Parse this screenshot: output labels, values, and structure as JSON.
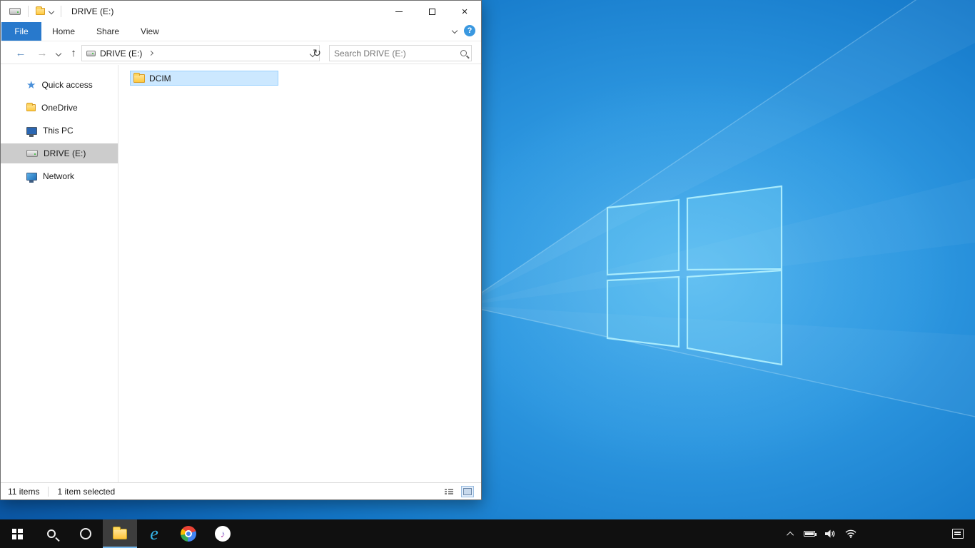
{
  "colors": {
    "accent_blue": "#0078d7",
    "file_tab_blue": "#2879cc",
    "selection_fill": "#cce8ff",
    "selection_border": "#99d1ff",
    "sidebar_selected_gray": "#cccccc",
    "taskbar_bg": "#101010",
    "wallpaper_light": "#41abec",
    "wallpaper_dark": "#0a53a0",
    "folder_yellow": "#ffca3e"
  },
  "window": {
    "title": "DRIVE (E:)",
    "ribbon_tabs": [
      {
        "label": "File",
        "active": true
      },
      {
        "label": "Home",
        "active": false
      },
      {
        "label": "Share",
        "active": false
      },
      {
        "label": "View",
        "active": false
      }
    ],
    "address": {
      "path": "DRIVE (E:)"
    },
    "search": {
      "placeholder": "Search DRIVE (E:)"
    },
    "sidebar": {
      "items": [
        {
          "label": "Quick access",
          "icon": "star-icon",
          "selected": false
        },
        {
          "label": "OneDrive",
          "icon": "folder-icon",
          "selected": false
        },
        {
          "label": "This PC",
          "icon": "computer-icon",
          "selected": false
        },
        {
          "label": "DRIVE (E:)",
          "icon": "drive-icon",
          "selected": true
        },
        {
          "label": "Network",
          "icon": "network-icon",
          "selected": false
        }
      ]
    },
    "files": [
      {
        "name": "DCIM",
        "type": "folder",
        "selected": true
      }
    ],
    "status": {
      "items_count": "11 items",
      "selection_count": "1 item selected"
    }
  },
  "glyphs": {
    "back": "←",
    "forward": "→",
    "up": "↑",
    "refresh": "↻",
    "help": "?",
    "close": "×",
    "star": "★",
    "music_note": "♪",
    "ie_letter": "e"
  },
  "taskbar": {
    "buttons": [
      {
        "name": "start",
        "active": false
      },
      {
        "name": "search",
        "active": false
      },
      {
        "name": "cortana",
        "active": false
      },
      {
        "name": "file-explorer",
        "active": true
      },
      {
        "name": "internet-explorer",
        "active": false
      },
      {
        "name": "chrome",
        "active": false
      },
      {
        "name": "itunes",
        "active": false
      }
    ]
  }
}
